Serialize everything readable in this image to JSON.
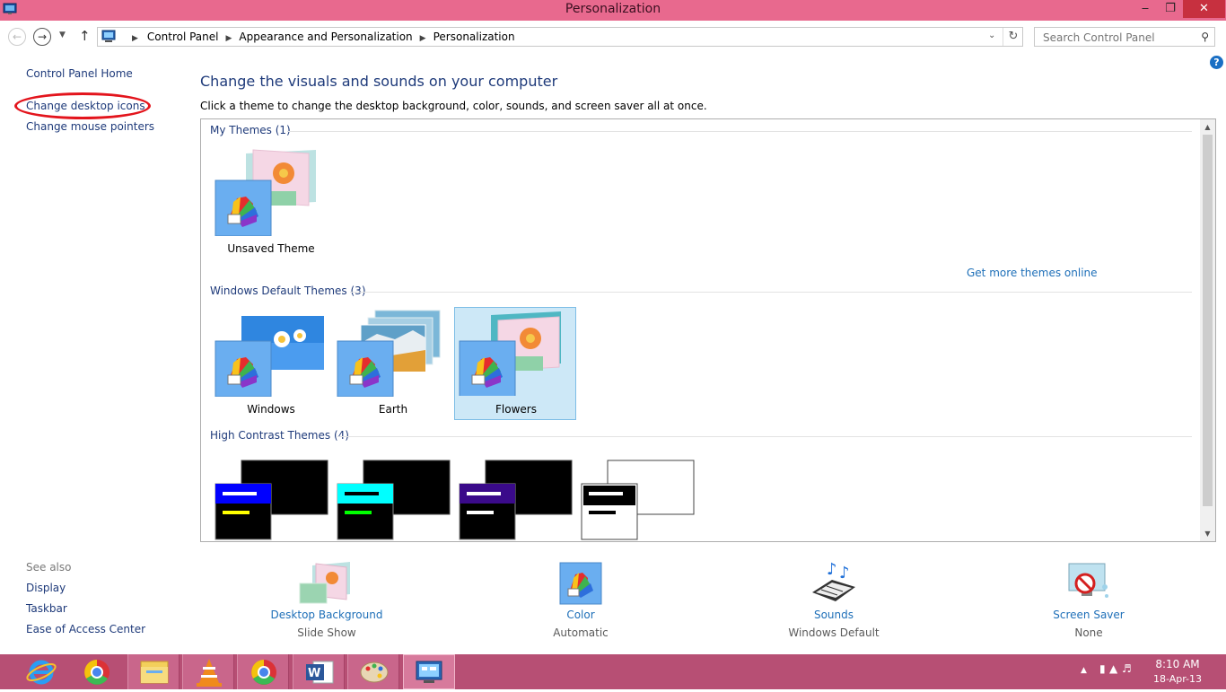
{
  "window": {
    "title": "Personalization",
    "minimize": "‒",
    "maximize": "❐",
    "close": "✕"
  },
  "address": {
    "crumbs": [
      "Control Panel",
      "Appearance and Personalization",
      "Personalization"
    ],
    "search_placeholder": "Search Control Panel"
  },
  "sidebar": {
    "items": [
      "Control Panel Home",
      "Change desktop icons",
      "Change mouse pointers"
    ],
    "see_also": "See also",
    "see_also_items": [
      "Display",
      "Taskbar",
      "Ease of Access Center"
    ]
  },
  "main": {
    "title": "Change the visuals and sounds on your computer",
    "description": "Click a theme to change the desktop background, color, sounds, and screen saver all at once.",
    "groups": {
      "my_themes": "My Themes (1)",
      "default_themes": "Windows Default Themes (3)",
      "high_contrast": "High Contrast Themes (4)"
    },
    "get_more": "Get more themes online",
    "themes": {
      "unsaved": "Unsaved Theme",
      "windows": "Windows",
      "earth": "Earth",
      "flowers": "Flowers"
    }
  },
  "bottom": {
    "background": {
      "label": "Desktop Background",
      "value": "Slide Show"
    },
    "color": {
      "label": "Color",
      "value": "Automatic"
    },
    "sounds": {
      "label": "Sounds",
      "value": "Windows Default"
    },
    "screensaver": {
      "label": "Screen Saver",
      "value": "None"
    }
  },
  "taskbar": {
    "time": "8:10 AM",
    "date": "18-Apr-13"
  },
  "colors": {
    "title_bar": "#e8698e",
    "taskbar": "#b74f74",
    "link": "#1e3a7a",
    "highlight_ellipse": "#e3141c"
  }
}
